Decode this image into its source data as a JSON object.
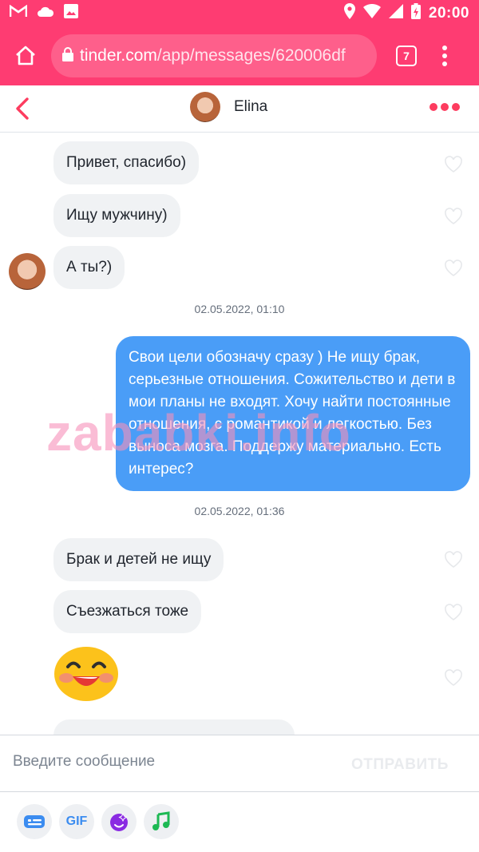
{
  "status_bar": {
    "time": "20:00",
    "icons": [
      "gmail-icon",
      "cloud-icon",
      "image-icon",
      "location-icon",
      "wifi-icon",
      "signal-icon",
      "battery-charging-icon"
    ]
  },
  "browser": {
    "url_host": "tinder.com",
    "url_path": "/app/messages/620006df",
    "tab_count": "7"
  },
  "chat": {
    "name": "Elina"
  },
  "messages": {
    "m1": "Привет, спасибо)",
    "m2": "Ищу мужчину)",
    "m3": "А ты?)",
    "ts1": "02.05.2022, 01:10",
    "out1": "Свои цели обозначу сразу ) Не ищу брак, серьезные отношения. Сожительство и дети в мои планы не входят. Хочу найти постоянные отношения, с романтикой и легкостью. Без выноса мозга. Поддержу материально. Есть интерес?",
    "ts2": "02.05.2022, 01:36",
    "m4": "Брак и детей не ищу",
    "m5": "Съезжаться тоже",
    "emoji": "smiling-face-emoji"
  },
  "watermark": "zababki.info",
  "composer": {
    "placeholder": "Введите сообщение",
    "send_label": "ОТПРАВИТЬ"
  },
  "toolbar": {
    "gif_label": "GIF"
  },
  "colors": {
    "brand": "#fe3c72",
    "bubble_out": "#4a9df7",
    "bubble_in": "#f0f2f4",
    "accent_red": "#fd3c5f"
  }
}
